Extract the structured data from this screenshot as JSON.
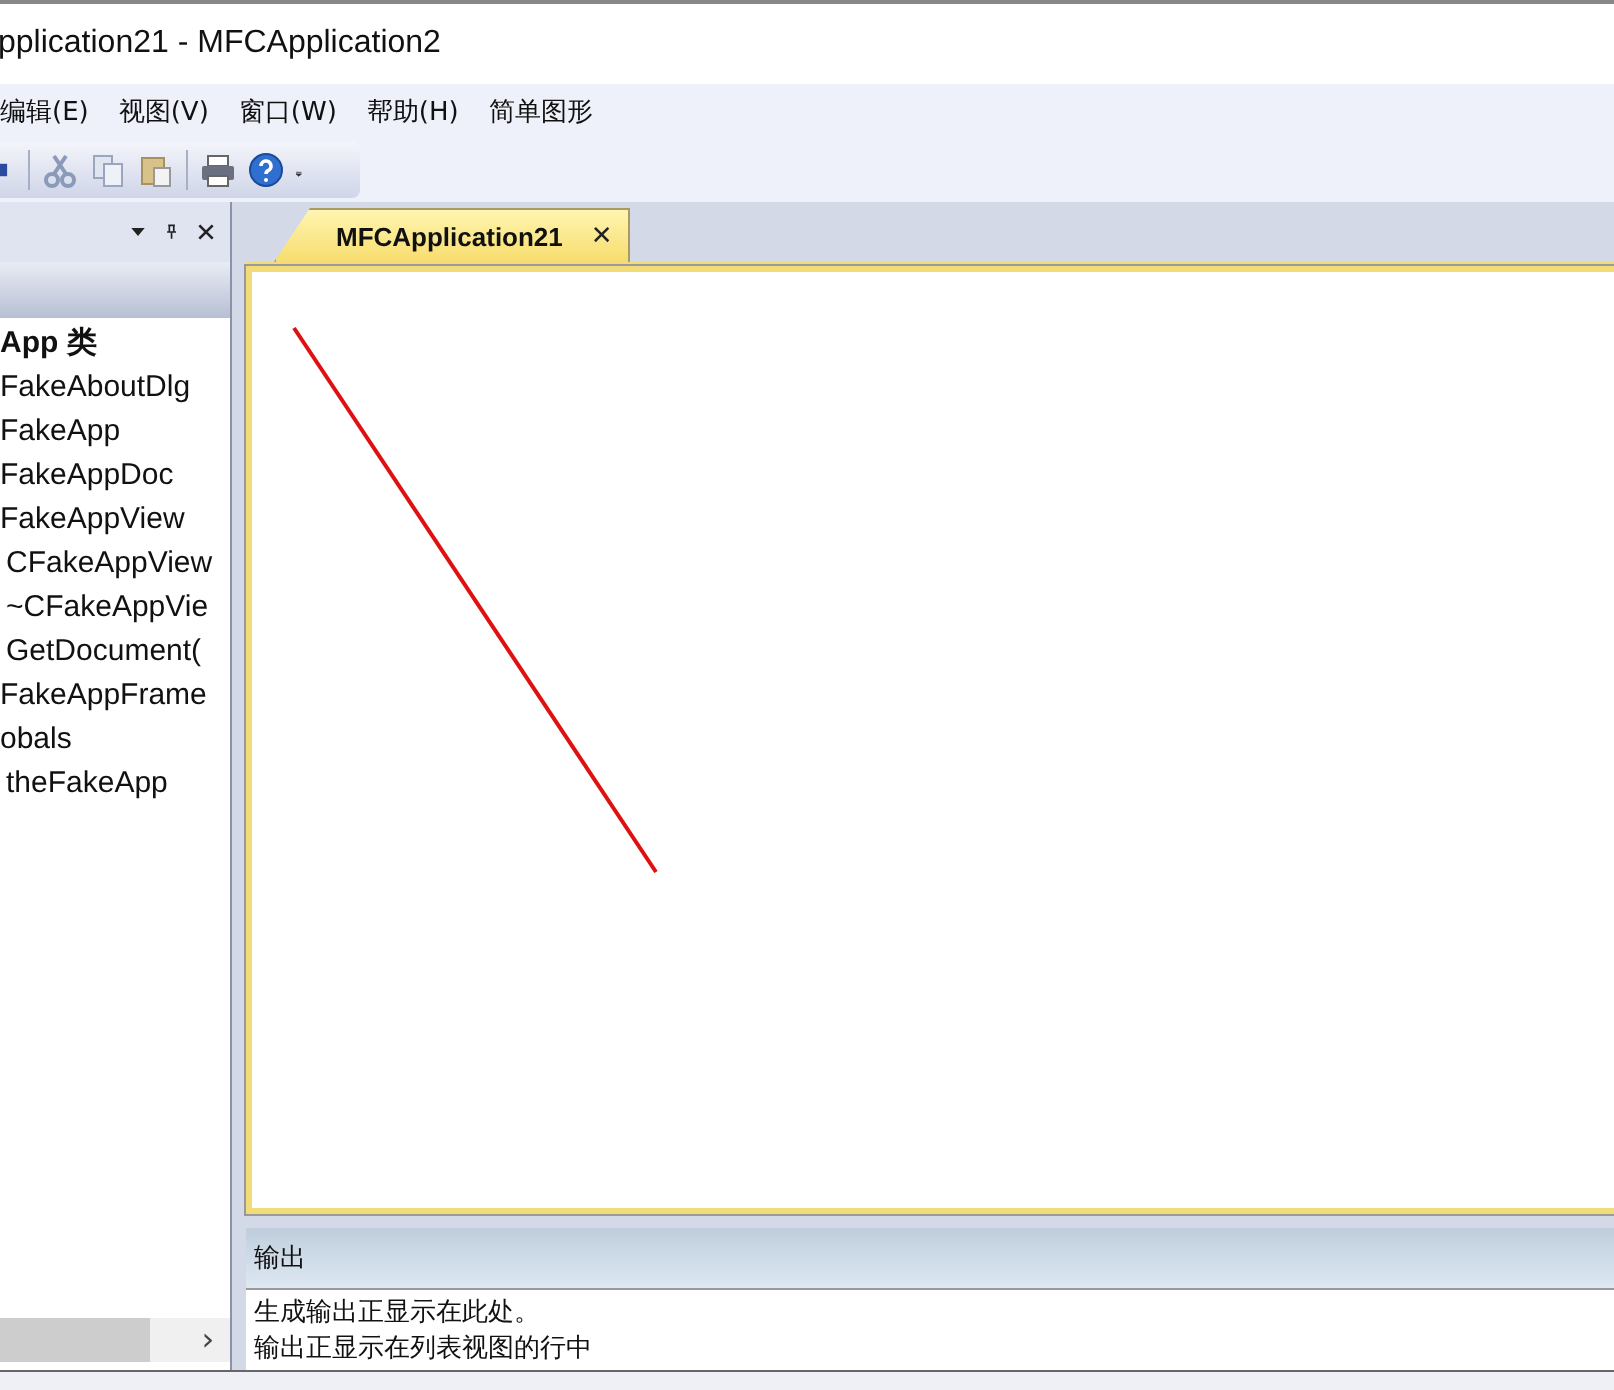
{
  "window": {
    "title": "pplication21 - MFCApplication2"
  },
  "menu": [
    "编辑(E)",
    "视图(V)",
    "窗口(W)",
    "帮助(H)",
    "简单图形"
  ],
  "class_view": {
    "tree": [
      {
        "label": "App 类",
        "children": [
          {
            "label": "FakeAboutDlg"
          },
          {
            "label": "FakeApp"
          },
          {
            "label": "FakeAppDoc"
          },
          {
            "label": "FakeAppView",
            "children": [
              {
                "label": "CFakeAppView"
              },
              {
                "label": "~CFakeAppVie"
              },
              {
                "label": "GetDocument("
              }
            ]
          },
          {
            "label": "FakeAppFrame"
          },
          {
            "label": "obals",
            "children": [
              {
                "label": "theFakeApp"
              }
            ]
          }
        ]
      }
    ],
    "scroll_arrow": "›"
  },
  "document_tab": {
    "label": "MFCApplication21",
    "close": "✕"
  },
  "output": {
    "title": "输出",
    "lines": [
      "生成输出正显示在此处。",
      "输出正显示在列表视图的行中"
    ]
  }
}
